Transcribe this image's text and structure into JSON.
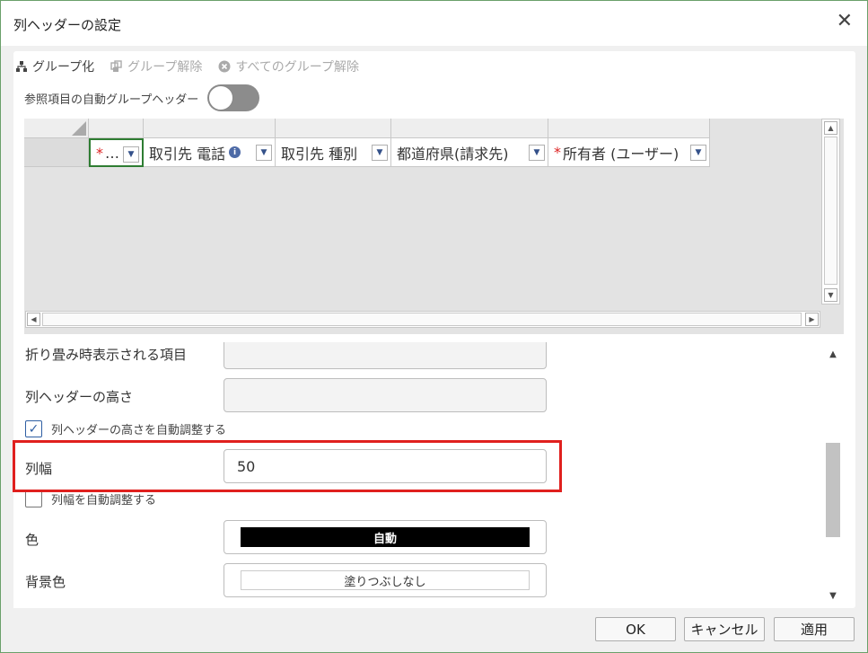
{
  "dialog": {
    "title": "列ヘッダーの設定",
    "close_icon": "close-icon"
  },
  "toolbar": {
    "group_label": "グループ化",
    "ungroup_label": "グループ解除",
    "ungroup_all_label": "すべてのグループ解除"
  },
  "toggle": {
    "label": "参照項目の自動グループヘッダー",
    "state": "off"
  },
  "grid": {
    "columns": [
      {
        "label": "…",
        "required": true,
        "info": false,
        "selected": true
      },
      {
        "label": "取引先 電話",
        "required": false,
        "info": true,
        "selected": false
      },
      {
        "label": "取引先 種別",
        "required": false,
        "info": false,
        "selected": false
      },
      {
        "label": "都道府県(請求先)",
        "required": false,
        "info": false,
        "selected": false
      },
      {
        "label": "所有者 (ユーザー)",
        "required": true,
        "info": false,
        "selected": false
      }
    ],
    "required_mark": "*",
    "info_mark": "i"
  },
  "props": {
    "collapsed_items_label": "折り畳み時表示される項目",
    "header_height_label": "列ヘッダーの高さ",
    "auto_height_label": "列ヘッダーの高さを自動調整する",
    "auto_height_checked": true,
    "col_width_label": "列幅",
    "col_width_value": "50",
    "auto_width_label": "列幅を自動調整する",
    "auto_width_checked": false,
    "color_label": "色",
    "color_value": "自動",
    "bg_color_label": "背景色",
    "bg_color_value": "塗りつぶしなし"
  },
  "footer": {
    "ok_label": "OK",
    "cancel_label": "キャンセル",
    "apply_label": "適用"
  },
  "colors": {
    "accent": "#2e7d32",
    "highlight": "#e0201e",
    "required": "#dd2222",
    "toggle_off": "#8c8c8c"
  }
}
